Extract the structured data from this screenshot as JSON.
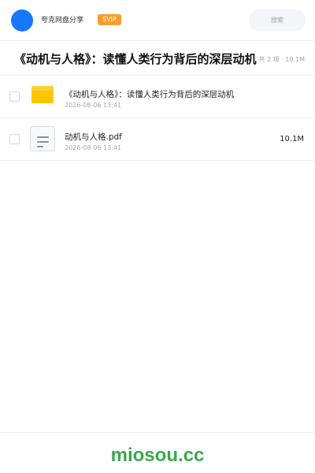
{
  "header": {
    "app_name": "夸克网盘分享",
    "badge": "SVIP",
    "search_label": "搜索"
  },
  "title_bar": {
    "title": "《动机与人格》：读懂人类行为背后的深层动机",
    "summary": "共 2 项 · 10.1M"
  },
  "files": [
    {
      "type": "folder",
      "icon": "folder-icon",
      "name": "《动机与人格》：读懂人类行为背后的深层动机",
      "date": "2026-08-06 13:41",
      "size": ""
    },
    {
      "type": "pdf",
      "icon": "document-icon",
      "name": "动机与人格.pdf",
      "date": "2026-08-06 13:41",
      "size": "10.1M"
    }
  ],
  "footer": {
    "watermark": "miosou.cc"
  },
  "colors": {
    "brand": "#1677ff",
    "badge": "#ff9b28",
    "folder": "#ffc400",
    "watermark": "#3aa84a"
  }
}
